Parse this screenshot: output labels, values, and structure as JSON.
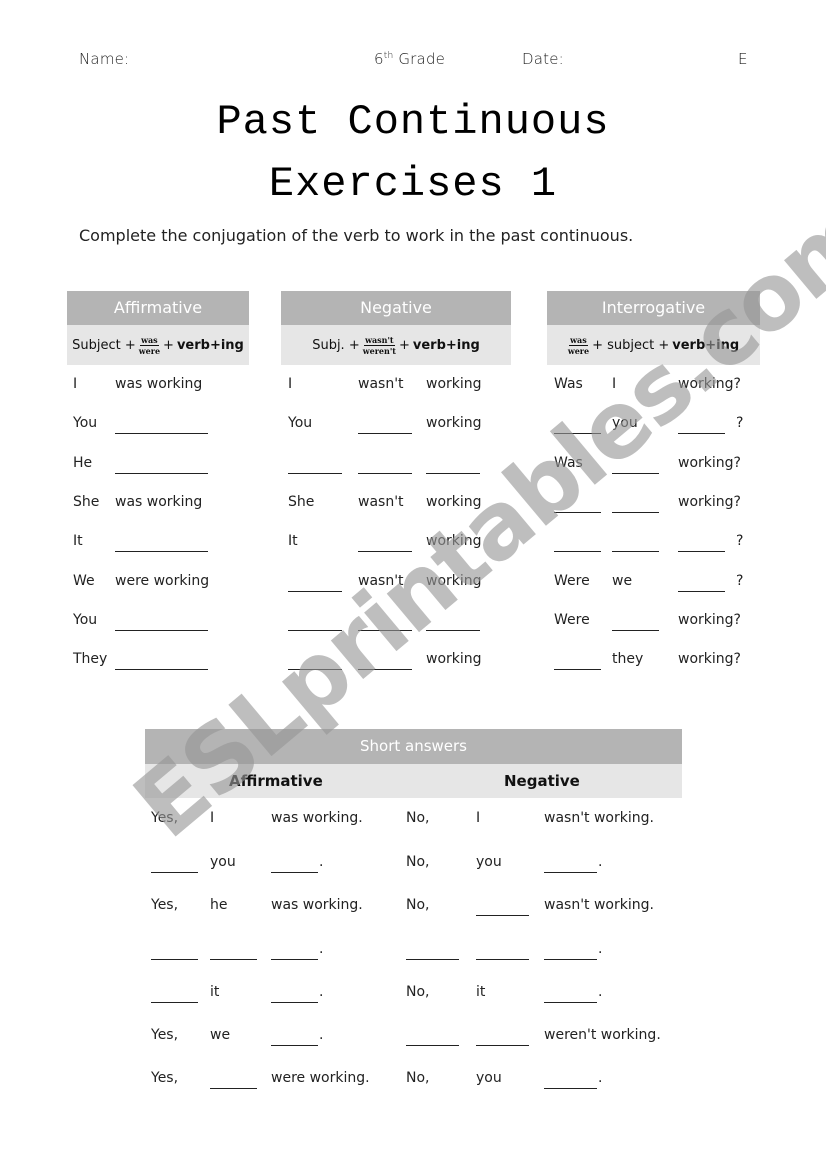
{
  "header": {
    "name_label": "Name:",
    "grade_num": "6",
    "grade_sup": "th",
    "grade_label": "Grade",
    "date_label": "Date:",
    "corner_letter": "E"
  },
  "title": {
    "line1": "Past Continuous",
    "line2": "Exercises 1"
  },
  "instruction": "Complete the conjugation of the verb to work in the past continuous.",
  "tables": {
    "affirmative": {
      "heading": "Affirmative",
      "formula": {
        "pre": "Subject +",
        "frac_top": "was",
        "frac_bottom": "were",
        "plus": "+",
        "verb": "verb+ing"
      },
      "rows": [
        {
          "subject": "I",
          "answer": "was working"
        },
        {
          "subject": "You",
          "answer": ""
        },
        {
          "subject": "He",
          "answer": ""
        },
        {
          "subject": "She",
          "answer": "was working"
        },
        {
          "subject": "It",
          "answer": ""
        },
        {
          "subject": "We",
          "answer": "were working"
        },
        {
          "subject": "You",
          "answer": ""
        },
        {
          "subject": "They",
          "answer": ""
        }
      ]
    },
    "negative": {
      "heading": "Negative",
      "formula": {
        "pre": "Subj. +",
        "frac_top": "wasn't",
        "frac_bottom": "weren't",
        "plus": "+",
        "verb": "verb+ing"
      },
      "rows": [
        {
          "subject": "I",
          "aux": "wasn't",
          "verb": "working"
        },
        {
          "subject": "You",
          "aux": "",
          "verb": "working"
        },
        {
          "subject": "",
          "aux": "",
          "verb": ""
        },
        {
          "subject": "She",
          "aux": "wasn't",
          "verb": "working"
        },
        {
          "subject": "It",
          "aux": "",
          "verb": "working"
        },
        {
          "subject": "",
          "aux": "wasn't",
          "verb": "working"
        },
        {
          "subject": "",
          "aux": "",
          "verb": ""
        },
        {
          "subject": "",
          "aux": "",
          "verb": "working"
        }
      ]
    },
    "interrogative": {
      "heading": "Interrogative",
      "formula": {
        "frac_top": "was",
        "frac_bottom": "were",
        "mid": "+ subject +",
        "verb": "verb+ing"
      },
      "rows": [
        {
          "aux": "Was",
          "subject": "I",
          "verb": "working?"
        },
        {
          "aux": "",
          "subject": "you",
          "verb": "",
          "qmark": "?"
        },
        {
          "aux": "Was",
          "subject": "",
          "verb": "working?"
        },
        {
          "aux": "",
          "subject": "",
          "verb": "working?"
        },
        {
          "aux": "",
          "subject": "",
          "verb": "",
          "qmark": "?"
        },
        {
          "aux": "Were",
          "subject": "we",
          "verb": "",
          "qmark": "?"
        },
        {
          "aux": "Were",
          "subject": "",
          "verb": "working?"
        },
        {
          "aux": "",
          "subject": "they",
          "verb": "working?"
        }
      ]
    }
  },
  "short_answers": {
    "heading": "Short answers",
    "affirmative_label": "Affirmative",
    "negative_label": "Negative",
    "rows": [
      {
        "a1": "Yes,",
        "a2": "I",
        "a3": "was working.",
        "n1": "No,",
        "n2": "I",
        "n3": "wasn't working."
      },
      {
        "a1": "",
        "a2": "you",
        "a3": "",
        "n1": "No,",
        "n2": "you",
        "n3": ""
      },
      {
        "a1": "Yes,",
        "a2": "he",
        "a3": "was working.",
        "n1": "No,",
        "n2": "",
        "n3": "wasn't working."
      },
      {
        "a1": "",
        "a2": "",
        "a3": "",
        "n1": "",
        "n2": "",
        "n3": ""
      },
      {
        "a1": "",
        "a2": "it",
        "a3": "",
        "n1": "No,",
        "n2": "it",
        "n3": ""
      },
      {
        "a1": "Yes,",
        "a2": "we",
        "a3": "",
        "n1": "",
        "n2": "",
        "n3": "weren't working."
      },
      {
        "a1": "Yes,",
        "a2": "",
        "a3": "were working.",
        "n1": "No,",
        "n2": "you",
        "n3": ""
      }
    ]
  },
  "watermark": "ESLprintables.com"
}
